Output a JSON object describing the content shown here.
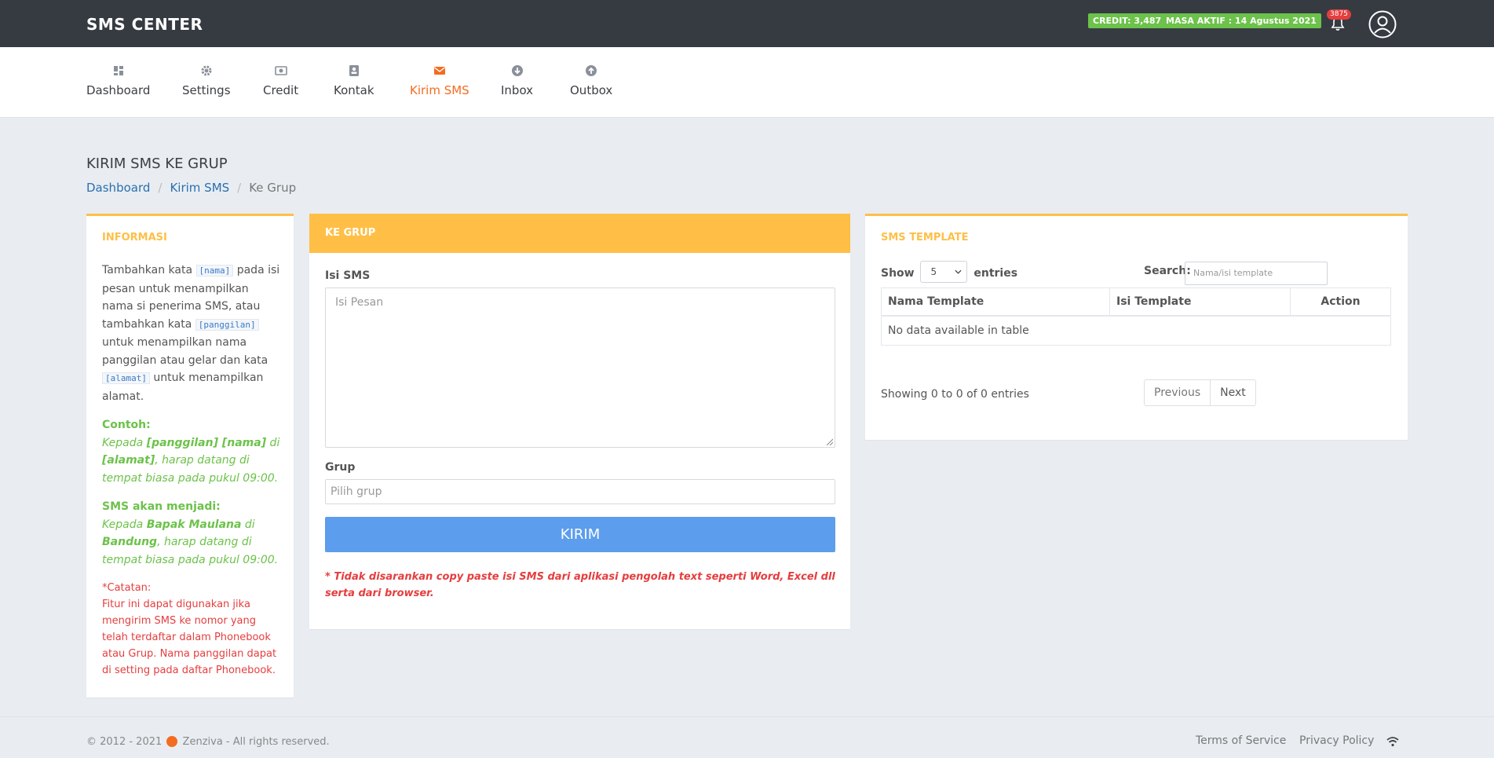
{
  "header": {
    "brand": "SMS CENTER",
    "credit": "CREDIT: 3,487",
    "masa_aktif": "MASA AKTIF : 14 Agustus 2021",
    "notification_count": "3875"
  },
  "nav": {
    "items": [
      {
        "label": "Dashboard",
        "icon": "dashboard-icon"
      },
      {
        "label": "Settings",
        "icon": "gear-icon"
      },
      {
        "label": "Credit",
        "icon": "money-icon"
      },
      {
        "label": "Kontak",
        "icon": "contact-icon"
      },
      {
        "label": "Kirim SMS",
        "icon": "envelope-icon",
        "active": true
      },
      {
        "label": "Inbox",
        "icon": "arrow-down-circle-icon"
      },
      {
        "label": "Outbox",
        "icon": "arrow-up-circle-icon"
      }
    ]
  },
  "page": {
    "title": "KIRIM SMS KE GRUP",
    "breadcrumb": [
      "Dashboard",
      "Kirim SMS",
      "Ke Grup"
    ]
  },
  "info": {
    "title": "INFORMASI",
    "text1": "Tambahkan kata ",
    "code_nama": "[nama]",
    "text2": " pada isi pesan untuk menampilkan nama si penerima SMS, atau tambahkan kata ",
    "code_panggilan": "[panggilan]",
    "text3": " untuk menampilkan nama panggilan atau gelar dan kata ",
    "code_alamat": "[alamat]",
    "text4": " untuk menampilkan alamat.",
    "contoh_label": "Contoh:",
    "contoh_a": "Kepada ",
    "contoh_b": "[panggilan] [nama]",
    "contoh_c": " di ",
    "contoh_d": "[alamat]",
    "contoh_e": ", harap datang di tempat biasa pada pukul 09:00.",
    "menjadi_label": "SMS akan menjadi:",
    "menjadi_a": "Kepada ",
    "menjadi_b": "Bapak Maulana",
    "menjadi_c": " di ",
    "menjadi_d": "Bandung",
    "menjadi_e": ", harap datang di tempat biasa pada pukul 09:00.",
    "catatan_label": "*Catatan:",
    "catatan_text": "Fitur ini dapat digunakan jika mengirim SMS ke nomor yang telah terdaftar dalam Phonebook atau Grup. Nama panggilan dapat di setting pada daftar Phonebook."
  },
  "form": {
    "title": "KE GRUP",
    "isi_label": "Isi SMS",
    "isi_placeholder": "Isi Pesan",
    "grup_label": "Grup",
    "grup_placeholder": "Pilih grup",
    "submit": "KIRIM",
    "warning": "* Tidak disarankan copy paste isi SMS dari aplikasi pengolah text seperti Word, Excel dll serta dari browser."
  },
  "template": {
    "title": "SMS TEMPLATE",
    "show": "Show",
    "entries_value": "5",
    "entries": "entries",
    "search_label": "Search:",
    "search_placeholder": "Nama/isi template",
    "columns": [
      "Nama Template",
      "Isi Template",
      "Action"
    ],
    "empty": "No data available in table",
    "showing": "Showing 0 to 0 of 0 entries",
    "prev": "Previous",
    "next": "Next"
  },
  "footer": {
    "copyright": "© 2012 - 2021",
    "company": "Zenziva - All rights reserved.",
    "terms": "Terms of Service",
    "privacy": "Privacy Policy"
  },
  "colors": {
    "topbar": "#363b42",
    "accent": "#f36c21",
    "card_accent": "#ffbf47",
    "button": "#5c9ded",
    "success": "#6cc24a",
    "danger": "#e53e3e"
  }
}
